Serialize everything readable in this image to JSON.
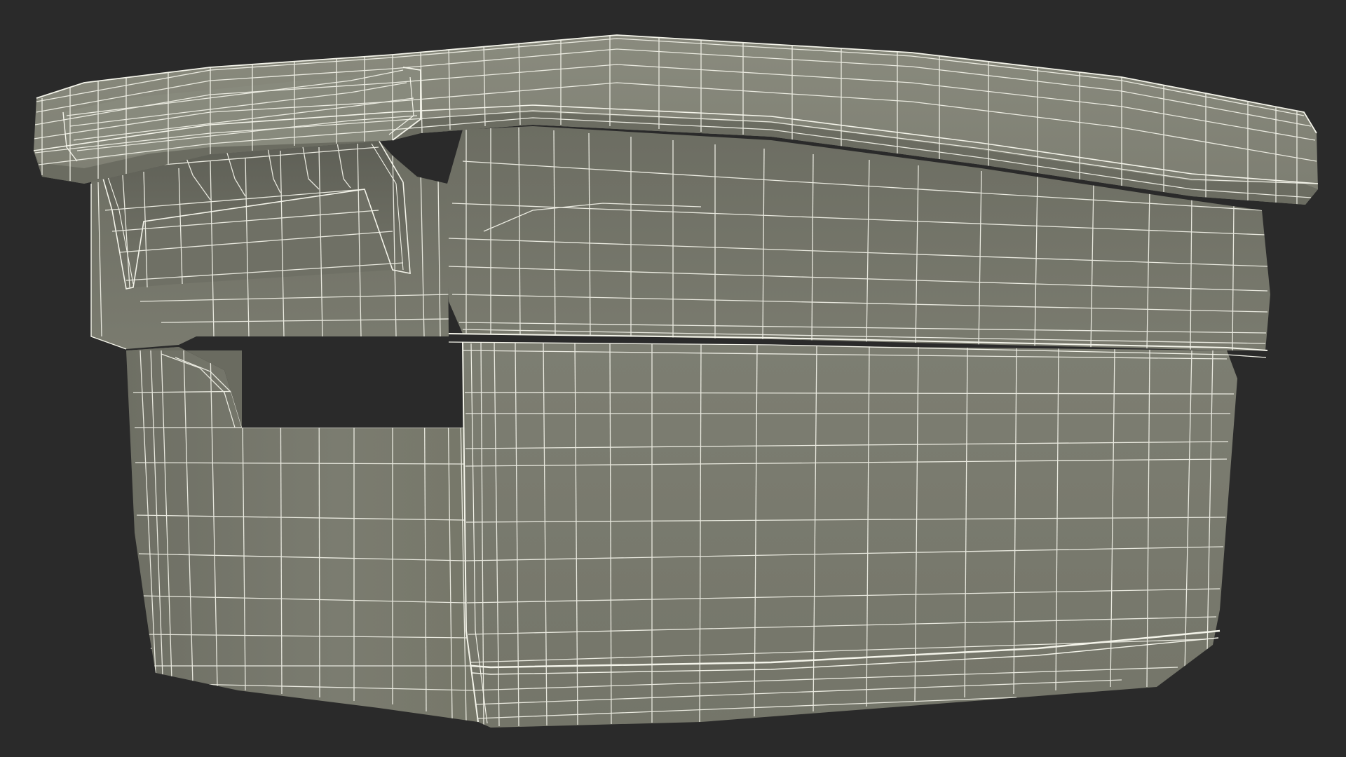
{
  "scene": {
    "subject": "wireframe-tub-model",
    "colors": {
      "background": "#2a2a2a",
      "surface_light": "#858679",
      "surface_mid": "#7a7b6f",
      "surface_dark": "#6a6b60",
      "shadow": "#55564d",
      "wire": "#f0f0e6"
    }
  }
}
